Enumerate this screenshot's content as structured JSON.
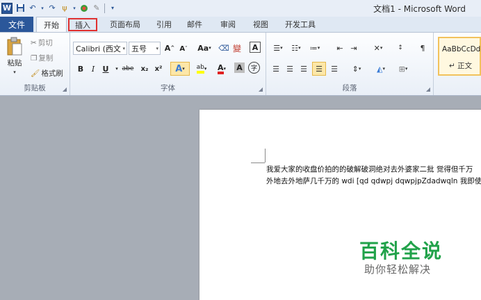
{
  "window": {
    "title": "文档1 - Microsoft Word"
  },
  "qat": {
    "logo": "W",
    "icons": [
      "save-icon",
      "undo-icon",
      "redo-icon",
      "format-painter-icon",
      "color-icon",
      "eraser-icon",
      "customize-icon"
    ]
  },
  "tabs": {
    "file": "文件",
    "items": [
      "开始",
      "插入",
      "页面布局",
      "引用",
      "邮件",
      "审阅",
      "视图",
      "开发工具"
    ]
  },
  "clipboard": {
    "label": "剪贴板",
    "paste": "粘贴",
    "cut": "剪切",
    "copy": "复制",
    "format_painter": "格式刷"
  },
  "font": {
    "label": "字体",
    "name": "Calibri (西文",
    "size": "五号",
    "grow": "A",
    "shrink": "A",
    "case": "Aa",
    "bold": "B",
    "italic": "I",
    "underline": "U",
    "strike": "abe",
    "sub": "x₂",
    "sup": "x²",
    "effects": "A",
    "highlight": "ab",
    "color": "A",
    "charshade": "A",
    "enclose": "字",
    "phonetic": "wén",
    "border": "A"
  },
  "paragraph": {
    "label": "段落"
  },
  "styles": {
    "sample": "AaBbCcDd",
    "name": "正文"
  },
  "document": {
    "lines": [
      "我爱大家的收盘价拍的的破解破洞绝对去外婆家二批  觉得但千万",
      "外地去外地萨几千万的 wdi [qd qdwpj dqwpjpZdadwqln 我即使是"
    ]
  },
  "watermark": {
    "title": "百科全说",
    "subtitle": "助你轻松解决"
  },
  "colors": {
    "accent": "#2b579a",
    "highlight": "#e0302f",
    "watermark": "#21a24a"
  }
}
